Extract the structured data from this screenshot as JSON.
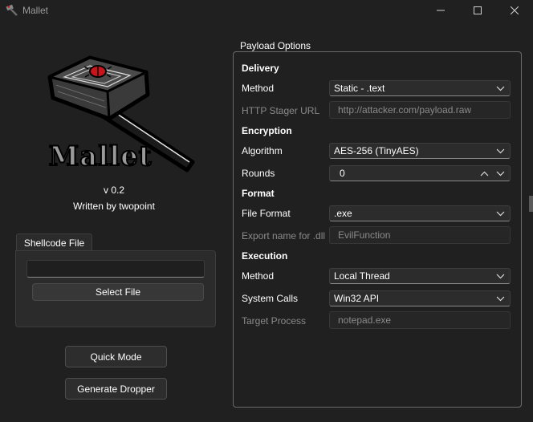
{
  "window": {
    "title": "Mallet",
    "icon": "hammer-icon",
    "controls": {
      "minimize": "minimize-icon",
      "maximize": "maximize-icon",
      "close": "close-icon"
    }
  },
  "about": {
    "logo": {
      "icon": "mallet-hammer-logo",
      "text": "Mallet"
    },
    "version": "v 0.2",
    "author": "Written by twopoint"
  },
  "shellcode": {
    "tab_label": "Shellcode File",
    "file_path_value": "",
    "select_button": "Select File"
  },
  "actions": {
    "quick_mode": "Quick Mode",
    "generate_dropper": "Generate Dropper"
  },
  "payload_options": {
    "title": "Payload Options",
    "delivery": {
      "heading": "Delivery",
      "method_label": "Method",
      "method_value": "Static - .text",
      "stager_url_label": "HTTP Stager URL",
      "stager_url_placeholder": "http://attacker.com/payload.raw"
    },
    "encryption": {
      "heading": "Encryption",
      "algorithm_label": "Algorithm",
      "algorithm_value": "AES-256 (TinyAES)",
      "rounds_label": "Rounds",
      "rounds_value": "0"
    },
    "format": {
      "heading": "Format",
      "file_format_label": "File Format",
      "file_format_value": ".exe",
      "export_name_label": "Export name for .dll",
      "export_name_placeholder": "EvilFunction"
    },
    "execution": {
      "heading": "Execution",
      "method_label": "Method",
      "method_value": "Local Thread",
      "system_calls_label": "System Calls",
      "system_calls_value": "Win32 API",
      "target_process_label": "Target Process",
      "target_process_placeholder": "notepad.exe"
    }
  },
  "colors": {
    "background": "#202020",
    "accent_red": "#c8151b",
    "disabled_text": "#8a8a8a"
  }
}
